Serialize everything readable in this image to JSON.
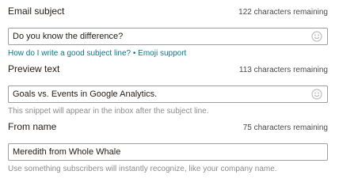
{
  "email_subject": {
    "label": "Email subject",
    "remaining": "122 characters remaining",
    "value": "Do you know the difference?",
    "help_link_1": "How do I write a good subject line?",
    "help_separator": "•",
    "help_link_2": "Emoji support"
  },
  "preview_text": {
    "label": "Preview text",
    "remaining": "113 characters remaining",
    "value": "Goals vs. Events in Google Analytics.",
    "help": "This snippet will appear in the inbox after the subject line."
  },
  "from_name": {
    "label": "From name",
    "remaining": "75 characters remaining",
    "value": "Meredith from Whole Whale",
    "help": "Use something subscribers will instantly recognize, like your company name."
  },
  "icons": {
    "emoji": "smiley-face-icon"
  }
}
